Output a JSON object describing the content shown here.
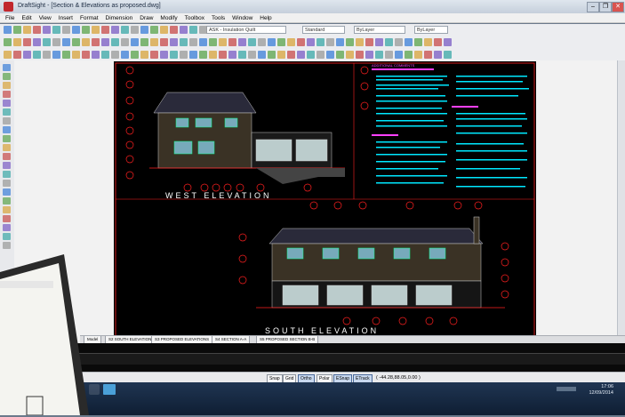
{
  "window": {
    "title": "DraftSight - [Section & Elevations as proposed.dwg]",
    "controls": [
      "–",
      "❐",
      "✕"
    ]
  },
  "menu": [
    "File",
    "Edit",
    "View",
    "Insert",
    "Format",
    "Dimension",
    "Draw",
    "Modify",
    "Toolbox",
    "Tools",
    "Window",
    "Help"
  ],
  "toolbar": {
    "layer_combo": "ASK - Insulation Quilt",
    "style_combo1": "Standard",
    "style_combo2": "ByLayer",
    "style_combo3": "ByLayer"
  },
  "drawing": {
    "west_title": "WEST ELEVATION",
    "south_title": "SOUTH ELEVATION",
    "notes_heading": "ADDITIONAL COMMENTS"
  },
  "tabs": [
    "Model",
    "S2 SOUTH ELEVATION",
    "S3 PROPOSED ELEVATIONS",
    "S4 SECTION A-A",
    "S5 PROPOSED SECTION B-B"
  ],
  "status": {
    "buttons": [
      {
        "label": "Snap",
        "on": false
      },
      {
        "label": "Grid",
        "on": false
      },
      {
        "label": "Ortho",
        "on": true
      },
      {
        "label": "Polar",
        "on": false
      },
      {
        "label": "ESnap",
        "on": true
      },
      {
        "label": "ETrack",
        "on": true
      }
    ],
    "coords": "( -44.28,88.05,0.00 )"
  },
  "taskbar": {
    "time": "17:06",
    "date": "12/09/2014"
  },
  "colors": {
    "drawing_bg": "#000000",
    "frame": "#ff2020",
    "notes_text": "#00e8ff",
    "heading": "#ff40ff",
    "title_text": "#ffffff"
  }
}
